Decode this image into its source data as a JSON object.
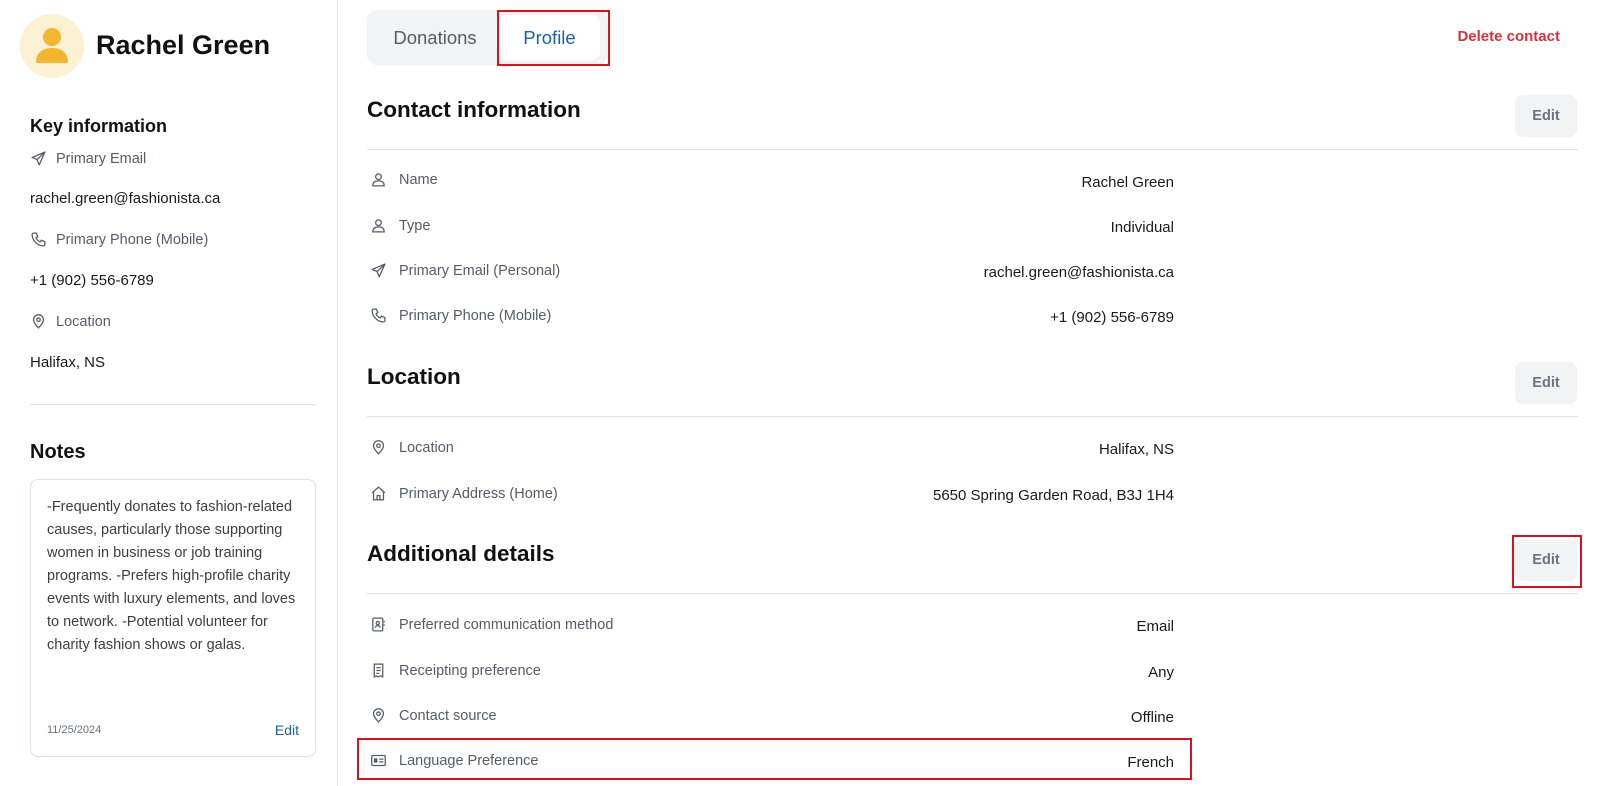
{
  "contact": {
    "name": "Rachel Green"
  },
  "key_information": {
    "title": "Key information",
    "items": [
      {
        "label": "Primary Email",
        "value": "rachel.green@fashionista.ca",
        "icon": "send-icon"
      },
      {
        "label": "Primary Phone (Mobile)",
        "value": "+1 (902) 556-6789",
        "icon": "phone-icon"
      },
      {
        "label": "Location",
        "value": "Halifax, NS",
        "icon": "location-pin-icon"
      }
    ]
  },
  "notes": {
    "title": "Notes",
    "text": "-Frequently donates to fashion-related causes, particularly those supporting women in business or job training programs. -Prefers high-profile charity events with luxury elements, and loves to network. -Potential volunteer for charity fashion shows or galas.",
    "date": "11/25/2024",
    "edit_label": "Edit"
  },
  "tabs": [
    {
      "label": "Donations",
      "active": false
    },
    {
      "label": "Profile",
      "active": true
    }
  ],
  "delete_label": "Delete contact",
  "sections": {
    "contact": {
      "title": "Contact information",
      "edit_label": "Edit",
      "rows": [
        {
          "label": "Name",
          "value": "Rachel Green",
          "icon": "user-icon"
        },
        {
          "label": "Type",
          "value": "Individual",
          "icon": "user-icon"
        },
        {
          "label": "Primary Email (Personal)",
          "value": "rachel.green@fashionista.ca",
          "icon": "send-icon"
        },
        {
          "label": "Primary Phone (Mobile)",
          "value": "+1 (902) 556-6789",
          "icon": "phone-icon"
        }
      ]
    },
    "location": {
      "title": "Location",
      "edit_label": "Edit",
      "rows": [
        {
          "label": "Location",
          "value": "Halifax, NS",
          "icon": "location-pin-icon"
        },
        {
          "label": "Primary Address (Home)",
          "value": "5650 Spring Garden Road, B3J 1H4",
          "icon": "home-icon"
        }
      ]
    },
    "additional": {
      "title": "Additional details",
      "edit_label": "Edit",
      "rows": [
        {
          "label": "Preferred communication method",
          "value": "Email",
          "icon": "contact-book-icon"
        },
        {
          "label": "Receipting preference",
          "value": "Any",
          "icon": "receipt-icon"
        },
        {
          "label": "Contact source",
          "value": "Offline",
          "icon": "location-pin-icon"
        },
        {
          "label": "Language Preference",
          "value": "French",
          "icon": "id-card-icon"
        }
      ]
    }
  },
  "colors": {
    "accent": "#1d5fa8",
    "danger": "#d6313d",
    "avatar_bg": "#fdf1d4",
    "avatar_fg": "#f2b632",
    "highlight": "#d9121f"
  }
}
